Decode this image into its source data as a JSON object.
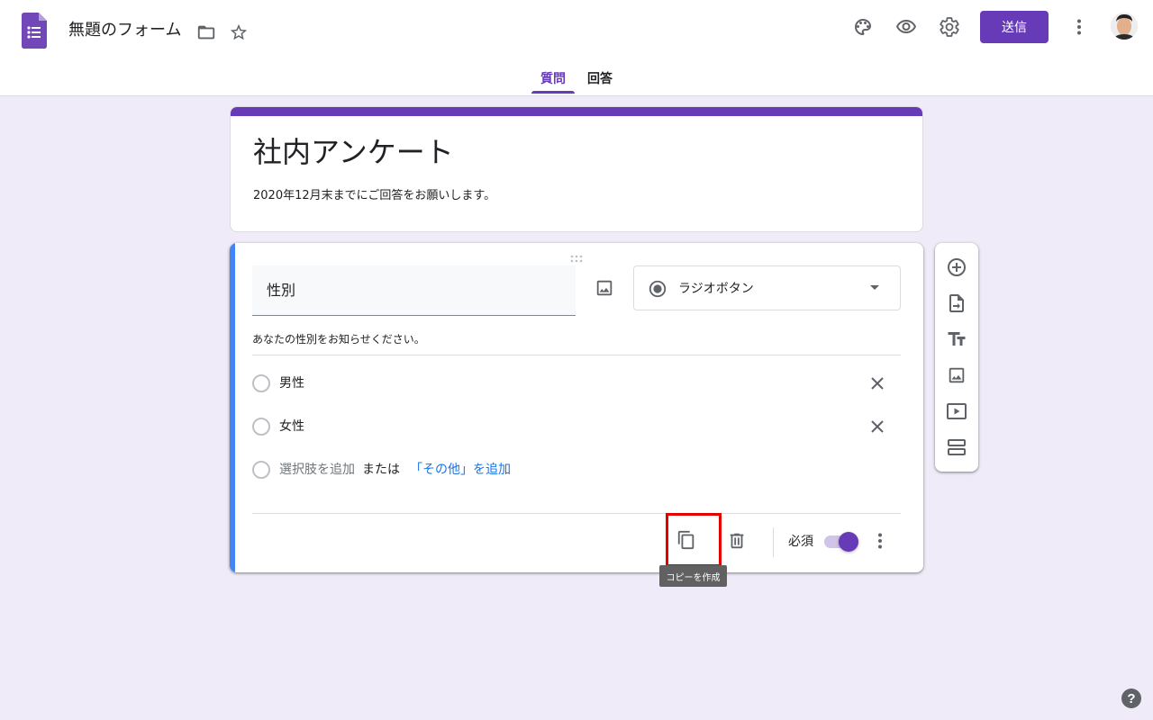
{
  "header": {
    "doc_title": "無題のフォーム",
    "send_label": "送信",
    "tabs": [
      {
        "label": "質問",
        "active": true
      },
      {
        "label": "回答",
        "active": false
      }
    ],
    "icons": [
      "forms-logo-icon",
      "folder-icon",
      "star-icon",
      "palette-icon",
      "preview-eye-icon",
      "settings-gear-icon",
      "more-vert-icon"
    ]
  },
  "form": {
    "title": "社内アンケート",
    "description": "2020年12月末までにご回答をお願いします。"
  },
  "question": {
    "title": "性別",
    "type_label": "ラジオボタン",
    "description": "あなたの性別をお知らせください。",
    "options": [
      {
        "label": "男性"
      },
      {
        "label": "女性"
      }
    ],
    "add_option_label": "選択肢を追加",
    "or_label": "または",
    "add_other_label": "「その他」を追加",
    "required_label": "必須",
    "required": true,
    "copy_tooltip": "コピーを作成"
  },
  "side_toolbar": [
    "add-question-icon",
    "import-questions-icon",
    "add-title-icon",
    "add-image-icon",
    "add-video-icon",
    "add-section-icon"
  ],
  "colors": {
    "theme": "#673ab7",
    "background": "#f0ebf8",
    "active_question_bar": "#4285f4",
    "link": "#1a73e8",
    "highlight": "#e50000"
  }
}
